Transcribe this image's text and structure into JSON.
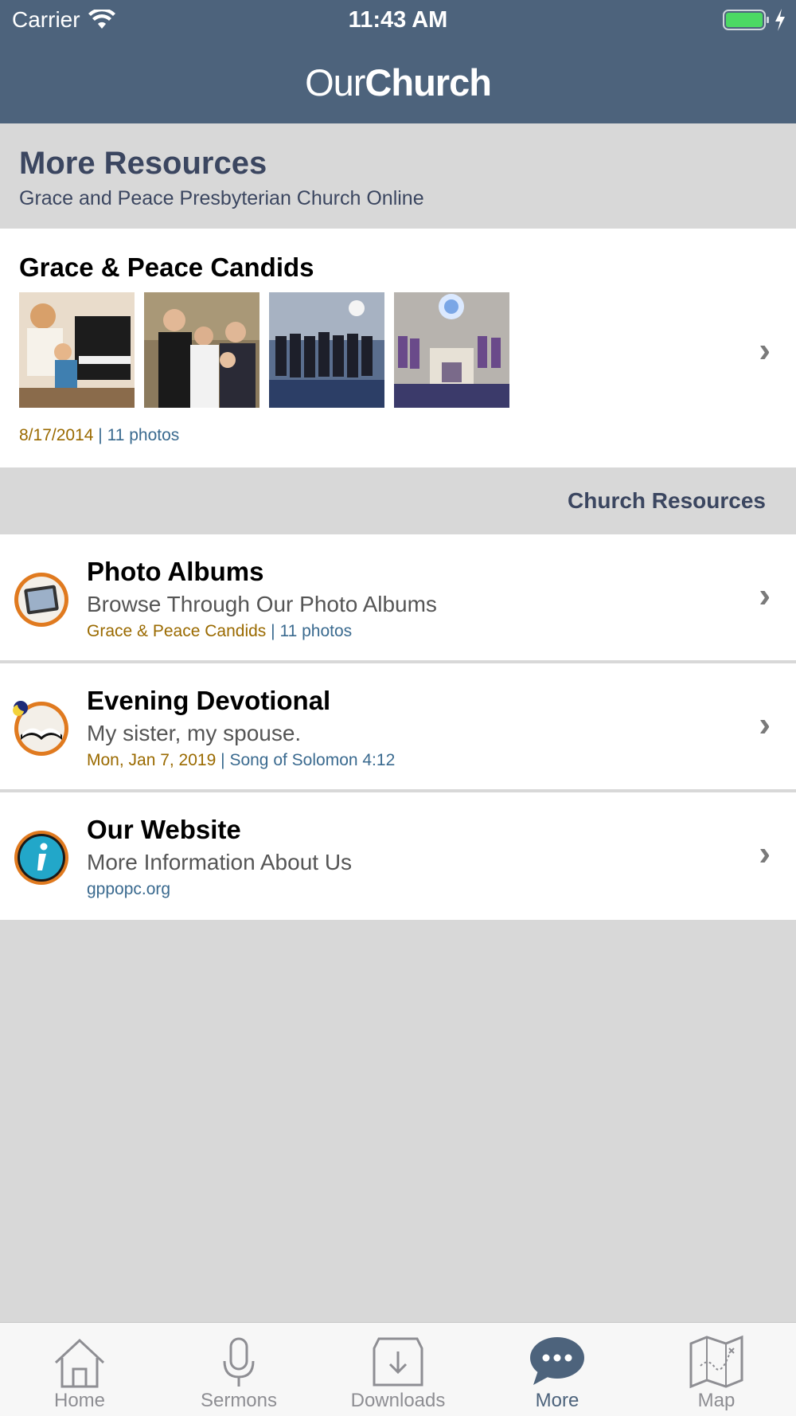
{
  "status_bar": {
    "carrier": "Carrier",
    "time": "11:43 AM"
  },
  "app": {
    "name_light": "Our",
    "name_bold": "Church"
  },
  "resources": {
    "title": "More Resources",
    "subtitle": "Grace and Peace Presbyterian Church Online"
  },
  "candids": {
    "title": "Grace & Peace Candids",
    "date": "8/17/2014",
    "separator": "|",
    "count": "11 photos"
  },
  "section": {
    "label": "Church Resources"
  },
  "rows": [
    {
      "title": "Photo Albums",
      "subtitle": "Browse Through Our Photo Albums",
      "meta_primary": "Grace & Peace Candids",
      "meta_separator": "|",
      "meta_secondary": "11 photos",
      "icon": "photo-album-icon"
    },
    {
      "title": "Evening Devotional",
      "subtitle": "My sister, my spouse.",
      "meta_primary": "Mon, Jan 7, 2019",
      "meta_separator": "|",
      "meta_secondary": "Song of Solomon 4:12",
      "icon": "open-book-icon"
    },
    {
      "title": "Our Website",
      "subtitle": "More Information About Us",
      "meta_secondary": "gppopc.org",
      "icon": "info-icon"
    }
  ],
  "tabs": [
    {
      "label": "Home",
      "icon": "home-icon"
    },
    {
      "label": "Sermons",
      "icon": "microphone-icon"
    },
    {
      "label": "Downloads",
      "icon": "download-tray-icon"
    },
    {
      "label": "More",
      "icon": "chat-bubble-icon",
      "active": true
    },
    {
      "label": "Map",
      "icon": "map-icon"
    }
  ],
  "colors": {
    "header_bg": "#4d637c",
    "date_accent": "#9a6a00",
    "link_accent": "#3a6a8f",
    "title_navy": "#3b4660"
  }
}
